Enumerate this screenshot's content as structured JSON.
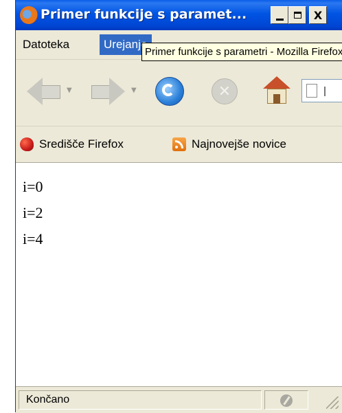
{
  "window": {
    "title": "Primer funkcije s paramet...",
    "buttons": {
      "minimize": "_",
      "maximize": "□",
      "close": "X"
    }
  },
  "menu": {
    "items": [
      "Datoteka",
      "Urejanje"
    ]
  },
  "tooltip": "Primer funkcije s parametri - Mozilla Firefox",
  "toolbar": {
    "back_icon": "back-arrow-icon",
    "forward_icon": "forward-arrow-icon",
    "reload_icon": "reload-icon",
    "stop_icon": "stop-icon",
    "home_icon": "home-icon"
  },
  "bookmarks": {
    "items": [
      "Središče Firefox",
      "Najnovejše novice"
    ]
  },
  "content": {
    "lines": [
      "i=0",
      "i=2",
      "i=4"
    ]
  },
  "status": {
    "text": "Končano"
  }
}
